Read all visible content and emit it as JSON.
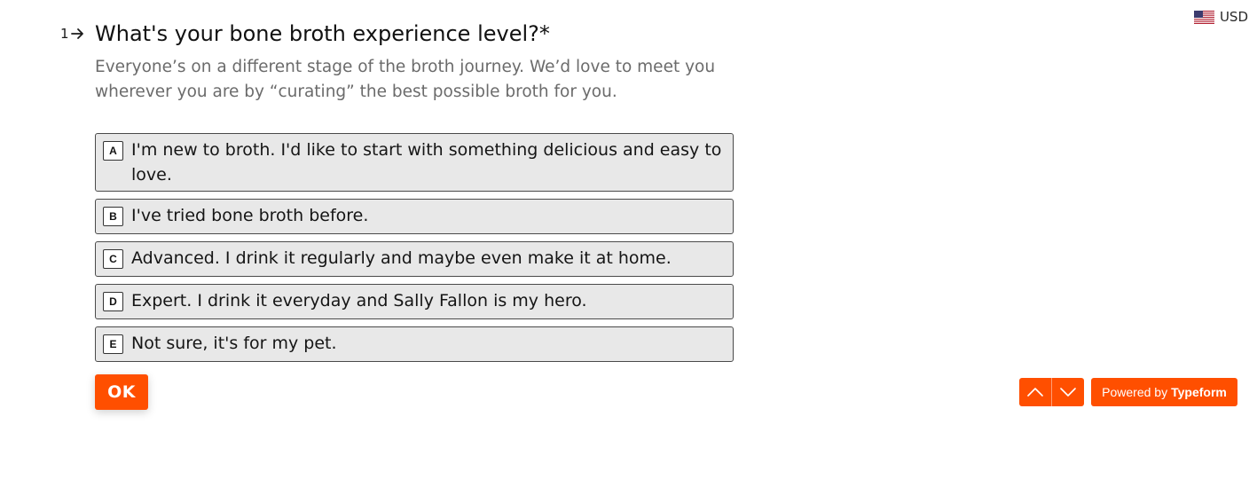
{
  "currency": {
    "label": "USD",
    "flag_icon": "us-flag-icon"
  },
  "question": {
    "number": "1",
    "title": "What's your bone broth experience level?*",
    "description": "Everyone’s on a different stage of the broth journey. We’d love to meet you wherever you are by “curating” the best possible broth for you."
  },
  "choices": [
    {
      "key": "A",
      "label": "I'm new to broth. I'd like to start with something delicious and easy to love."
    },
    {
      "key": "B",
      "label": "I've tried bone broth before."
    },
    {
      "key": "C",
      "label": "Advanced. I drink it regularly and maybe even make it at home."
    },
    {
      "key": "D",
      "label": "Expert. I drink it everyday and Sally Fallon is my hero."
    },
    {
      "key": "E",
      "label": "Not sure, it's for my pet."
    }
  ],
  "ok_label": "OK",
  "footer": {
    "powered_prefix": "Powered by",
    "powered_brand": "Typeform",
    "nav_up_icon": "chevron-up-icon",
    "nav_down_icon": "chevron-down-icon"
  },
  "colors": {
    "accent": "#ff4f00",
    "choice_bg": "#e8e8e8",
    "choice_border": "#4a4a4a",
    "description_text": "#6b6b6b"
  }
}
